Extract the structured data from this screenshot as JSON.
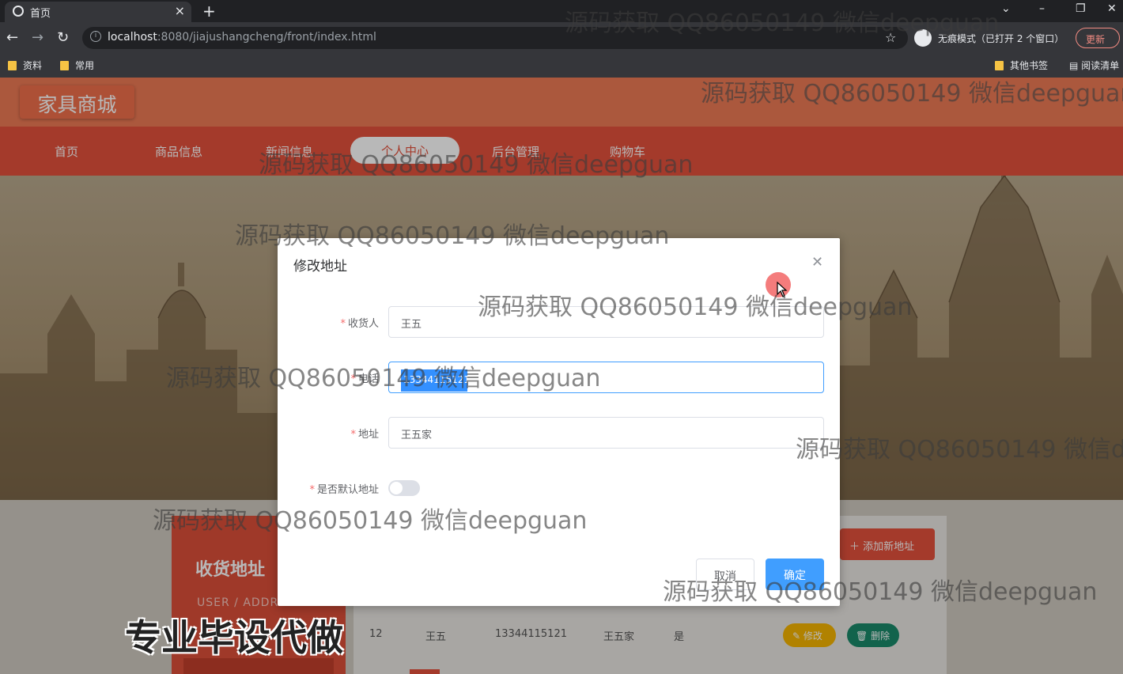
{
  "browser": {
    "tab_title": "首页",
    "url_host": "localhost",
    "url_rest": ":8080/jiajushangcheng/front/index.html",
    "incognito_label": "无痕模式（已打开 2 个窗口）",
    "update_label": "更新",
    "bookmarks": [
      "资料",
      "常用"
    ],
    "other_bookmarks": "其他书签",
    "reading_list": "阅读清单"
  },
  "site": {
    "logo": "家具商城",
    "nav": [
      "首页",
      "商品信息",
      "新闻信息",
      "个人中心",
      "后台管理",
      "购物车"
    ],
    "active_nav_index": 3
  },
  "address_page": {
    "panel_title": "收货地址",
    "panel_subtitle": "USER / ADDRESS",
    "add_button": "添加新地址",
    "row": {
      "id": "12",
      "name": "王五",
      "phone": "13344115121",
      "address": "王五家",
      "is_default": "是"
    },
    "edit_button": "修改",
    "delete_button": "删除"
  },
  "dialog": {
    "title": "修改地址",
    "fields": {
      "consignee": {
        "label": "收货人",
        "value": "王五"
      },
      "phone": {
        "label": "电话",
        "value": "13344115121"
      },
      "address": {
        "label": "地址",
        "value": "王五家"
      },
      "is_default": {
        "label": "是否默认地址",
        "value": false
      }
    },
    "cancel": "取消",
    "confirm": "确定"
  },
  "watermark": "源码获取 QQ86050149 微信deepguan",
  "promo": "专业毕设代做",
  "colors": {
    "header": "#ee7a55",
    "nav": "#e4513c",
    "primary": "#409eff",
    "edit": "#f5b400",
    "delete": "#1a8a6a"
  }
}
